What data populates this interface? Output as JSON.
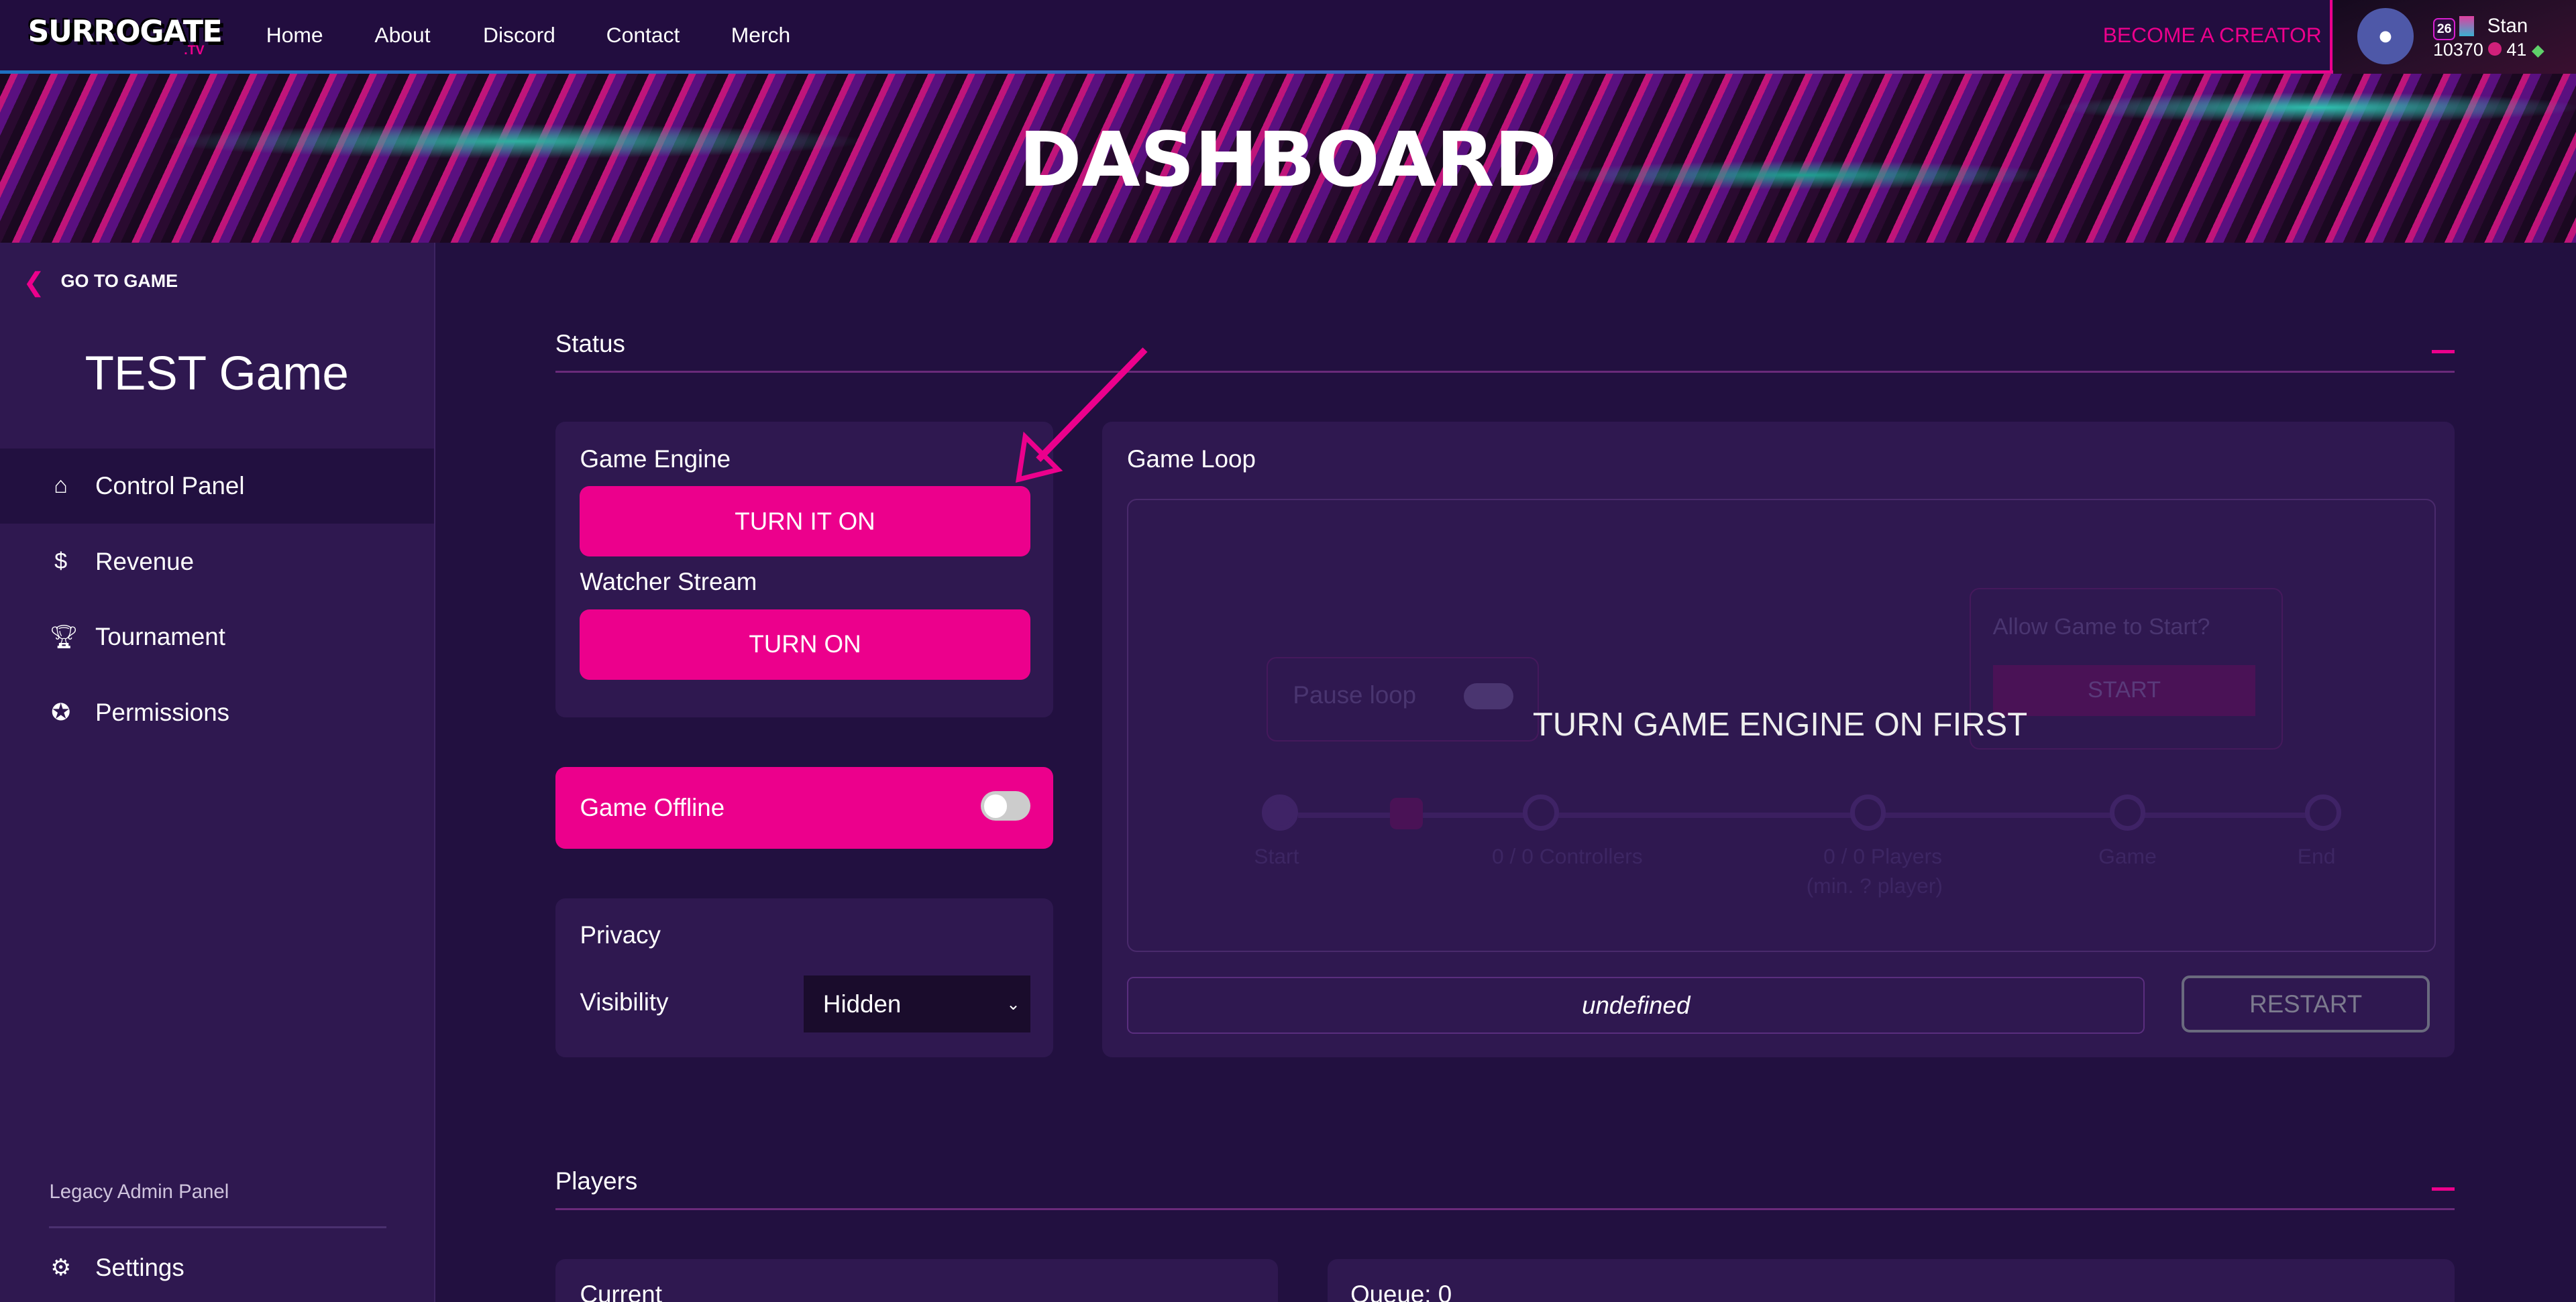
{
  "header": {
    "logo": "SURROGATE",
    "logo_suffix": ".TV",
    "nav": [
      "Home",
      "About",
      "Discord",
      "Contact",
      "Merch"
    ],
    "become_creator": "BECOME A CREATOR",
    "user": {
      "level": "26",
      "name": "Stan",
      "coins": "10370",
      "gems": "41"
    }
  },
  "banner": {
    "title": "DASHBOARD"
  },
  "sidebar": {
    "back": "GO TO GAME",
    "game_title": "TEST Game",
    "items": [
      {
        "label": "Control Panel",
        "icon": "home-icon"
      },
      {
        "label": "Revenue",
        "icon": "dollar-icon"
      },
      {
        "label": "Tournament",
        "icon": "trophy-icon"
      },
      {
        "label": "Permissions",
        "icon": "award-icon"
      }
    ],
    "legacy": "Legacy Admin Panel",
    "settings": "Settings"
  },
  "status": {
    "title": "Status",
    "game_engine": {
      "label": "Game Engine",
      "button": "TURN IT ON"
    },
    "watcher_stream": {
      "label": "Watcher Stream",
      "button": "TURN ON"
    },
    "offline": {
      "label": "Game Offline",
      "toggle_on": false
    },
    "privacy": {
      "title": "Privacy",
      "visibility_label": "Visibility",
      "visibility_value": "Hidden"
    },
    "game_loop": {
      "title": "Game Loop",
      "overlay": "TURN GAME ENGINE ON FIRST",
      "pause_loop": "Pause loop",
      "allow_start": "Allow Game to Start?",
      "start": "START",
      "steps": [
        "Start",
        "0 / 0 Controllers",
        "0 / 0 Players",
        "Game",
        "End"
      ],
      "players_min": "(min. ? player)",
      "output": "undefined",
      "restart": "RESTART"
    }
  },
  "players": {
    "title": "Players",
    "current": "Current",
    "queue": "Queue: 0"
  },
  "colors": {
    "accent": "#ec008c",
    "bg": "#221040",
    "card": "#2f1850"
  }
}
